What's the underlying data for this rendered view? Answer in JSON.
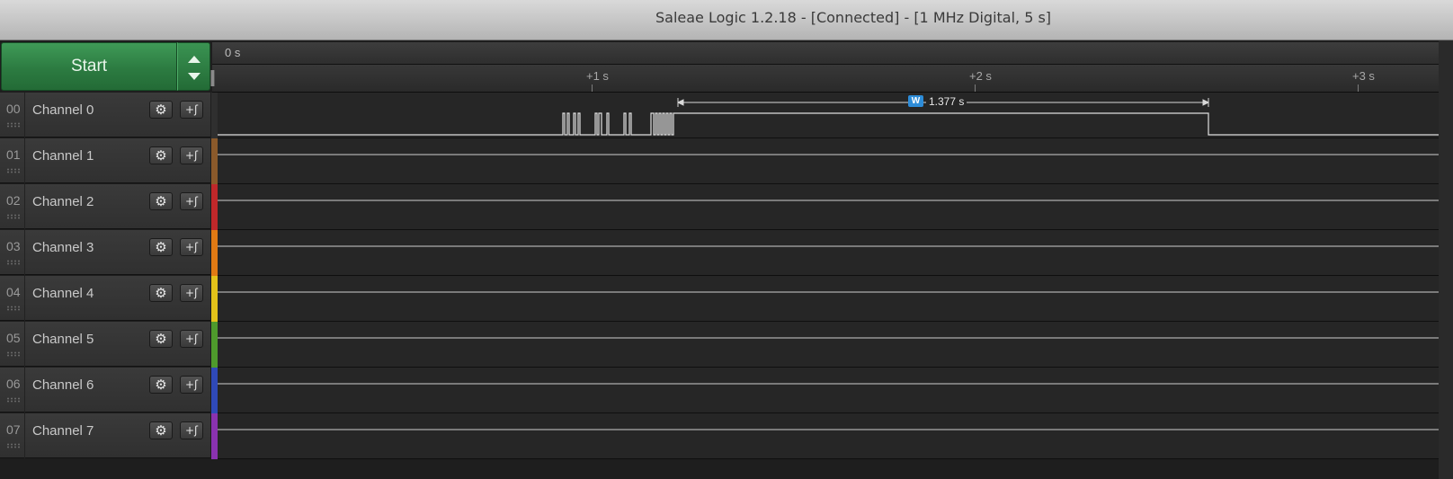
{
  "window": {
    "title": "Saleae Logic 1.2.18 - [Connected] - [1 MHz Digital, 5 s]"
  },
  "start": {
    "label": "Start"
  },
  "timeline": {
    "origin_label": "0 s",
    "ticks": [
      "+1 s",
      "+2 s",
      "+3 s"
    ]
  },
  "measurement": {
    "badge": "W",
    "width_label": "1.377 s"
  },
  "channels": [
    {
      "num": "00",
      "name": "Channel 0",
      "color": "#2f2f2f"
    },
    {
      "num": "01",
      "name": "Channel 1",
      "color": "#8b5a2b"
    },
    {
      "num": "02",
      "name": "Channel 2",
      "color": "#c0282a"
    },
    {
      "num": "03",
      "name": "Channel 3",
      "color": "#e07a14"
    },
    {
      "num": "04",
      "name": "Channel 4",
      "color": "#e3c21a"
    },
    {
      "num": "05",
      "name": "Channel 5",
      "color": "#4e9a2c"
    },
    {
      "num": "06",
      "name": "Channel 6",
      "color": "#2f49b8"
    },
    {
      "num": "07",
      "name": "Channel 7",
      "color": "#8a32b0"
    }
  ],
  "icons": {
    "settings": "gear-icon",
    "trigger": "trigger-edge-icon",
    "start_options": "up-down-arrows-icon"
  }
}
